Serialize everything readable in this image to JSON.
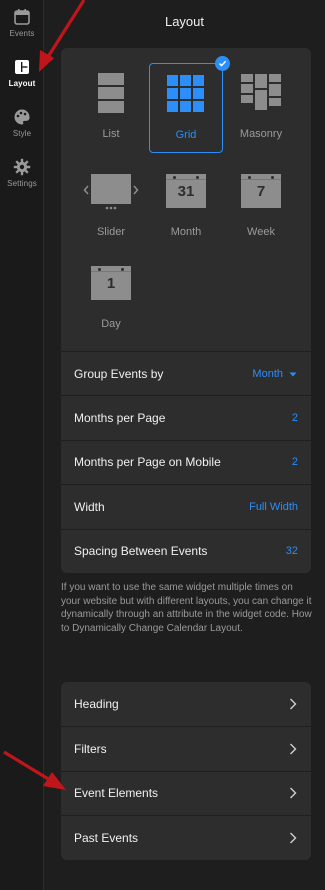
{
  "rail": {
    "items": [
      {
        "label": "Events",
        "icon": "calendar-icon"
      },
      {
        "label": "Layout",
        "icon": "layout-icon"
      },
      {
        "label": "Style",
        "icon": "palette-icon"
      },
      {
        "label": "Settings",
        "icon": "gear-icon"
      }
    ],
    "active": "Layout"
  },
  "panel": {
    "title": "Layout"
  },
  "layouts": {
    "options": [
      "List",
      "Grid",
      "Masonry",
      "Slider",
      "Month",
      "Week",
      "Day"
    ],
    "selected": "Grid",
    "month_icon_number": "31",
    "week_icon_number": "7",
    "day_icon_number": "1"
  },
  "settings": [
    {
      "label": "Group Events by",
      "value": "Month"
    },
    {
      "label": "Months per Page",
      "value": "2"
    },
    {
      "label": "Months per Page on Mobile",
      "value": "2"
    },
    {
      "label": "Width",
      "value": "Full Width"
    },
    {
      "label": "Spacing Between Events",
      "value": "32"
    }
  ],
  "help_text": "If you want to use the same widget multiple times on your website but with different layouts, you can change it dynamically through an attribute in the widget code. How to Dynamically Change Calendar Layout.",
  "sections": [
    "Heading",
    "Filters",
    "Event Elements",
    "Past Events"
  ],
  "colors": {
    "accent": "#2c8ef8",
    "panel": "#2d2d2d",
    "background": "#1e1e1e",
    "annotation_arrow": "#c0161b"
  }
}
